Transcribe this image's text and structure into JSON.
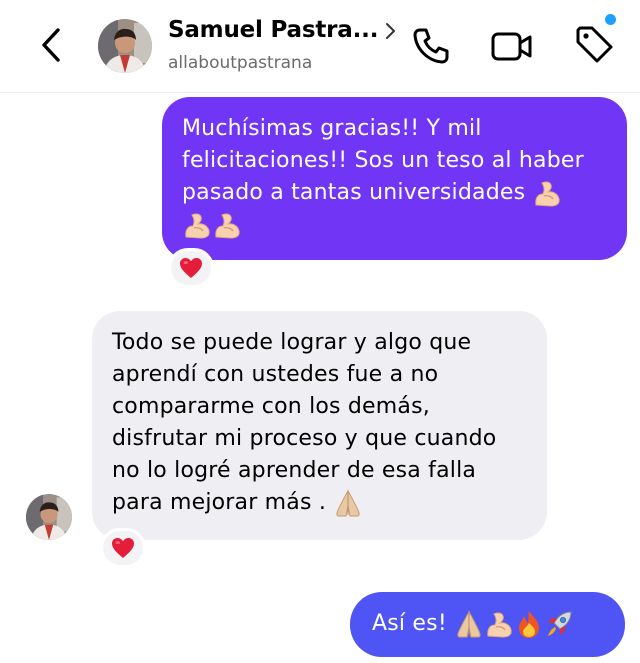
{
  "header": {
    "title": "Samuel Pastra...",
    "username": "allaboutpastrana",
    "icons": [
      "back-arrow-icon",
      "chevron-right-icon",
      "phone-icon",
      "video-camera-icon",
      "tag-icon"
    ],
    "notification_dot_color": "#1ea0ff"
  },
  "messages": [
    {
      "direction": "sent",
      "lines": [
        "Muchísimas gracias!! Y mil",
        "felicitaciones!! Sos un teso al haber",
        "pasado a tantas universidades"
      ],
      "emojis": [
        "flexed-biceps",
        "flexed-biceps",
        "flexed-biceps"
      ],
      "reaction": "red-heart",
      "bubble_color": "#7136f5"
    },
    {
      "direction": "received",
      "lines": [
        "Todo se puede lograr y algo que",
        "aprendí con ustedes fue a no",
        "compararme con los demás,",
        "disfrutar mi proceso y que cuando",
        "no lo logré aprender de esa falla",
        "para mejorar más ."
      ],
      "emojis": [
        "folded-hands"
      ],
      "reaction": "red-heart",
      "bubble_color": "#efeff3"
    },
    {
      "direction": "sent",
      "text": "Así es!",
      "emojis": [
        "folded-hands",
        "flexed-biceps",
        "fire",
        "rocket"
      ],
      "bubble_color": "#4f55f4"
    }
  ]
}
